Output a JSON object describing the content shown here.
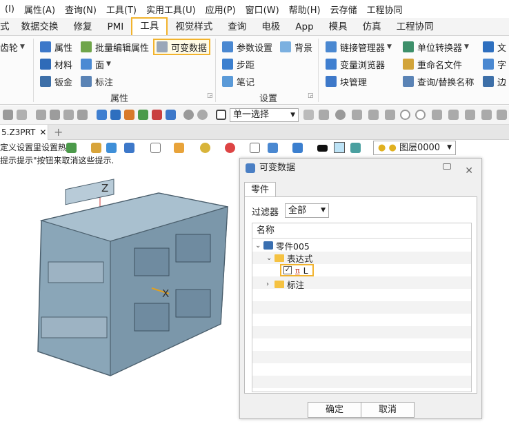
{
  "menubar": {
    "items": [
      "(I)",
      "属性(A)",
      "查询(N)",
      "工具(T)",
      "实用工具(U)",
      "应用(P)",
      "窗口(W)",
      "帮助(H)",
      "云存储",
      "工程协同"
    ]
  },
  "ribbon_tabs": {
    "items": [
      "式",
      "数据交换",
      "修复",
      "PMI",
      "工具",
      "视觉样式",
      "查询",
      "电极",
      "App",
      "模具",
      "仿真",
      "工程协同"
    ],
    "active": "工具"
  },
  "ribbon": {
    "gear": "齿轮",
    "attr": {
      "properties": "属性",
      "batch_edit": "批量编辑属性",
      "variable_data": "可变数据",
      "material": "材料",
      "face": "面",
      "sheet_metal": "钣金",
      "annotation": "标注",
      "group_label": "属性"
    },
    "settings": {
      "param_settings": "参数设置",
      "background": "背景",
      "step": "步距",
      "notes": "笔记",
      "group_label": "设置"
    },
    "tools": {
      "link_manager": "链接管理器",
      "unit_converter": "单位转换器",
      "text": "文",
      "var_browser": "变量浏览器",
      "rename_file": "重命名文件",
      "char": "字",
      "block_manager": "块管理",
      "find_replace": "查询/替换名称",
      "edge": "边"
    }
  },
  "toolbar": {
    "filter_value": "单一选择",
    "layer_value": "图层0000"
  },
  "document": {
    "tab_label": "5.Z3PRT",
    "close": "✕",
    "new_tab": "+"
  },
  "hints": {
    "line1": "定义设置里设置热",
    "line2": "提示提示\"按钮来取消这些提示."
  },
  "viewport": {
    "axis_z": "Z",
    "axis_x": "X"
  },
  "dialog": {
    "title": "可变数据",
    "close": "✕",
    "tab": "零件",
    "filter_label": "过滤器",
    "filter_value": "全部",
    "column_header": "名称",
    "tree": {
      "root": "零件005",
      "expressions": "表达式",
      "expr_item": "L",
      "expr_symbol": "π",
      "annotation": "标注"
    },
    "ok": "确定",
    "cancel": "取消"
  },
  "colors": {
    "highlight": "#f2b32d",
    "model": "#8aa6b8"
  }
}
